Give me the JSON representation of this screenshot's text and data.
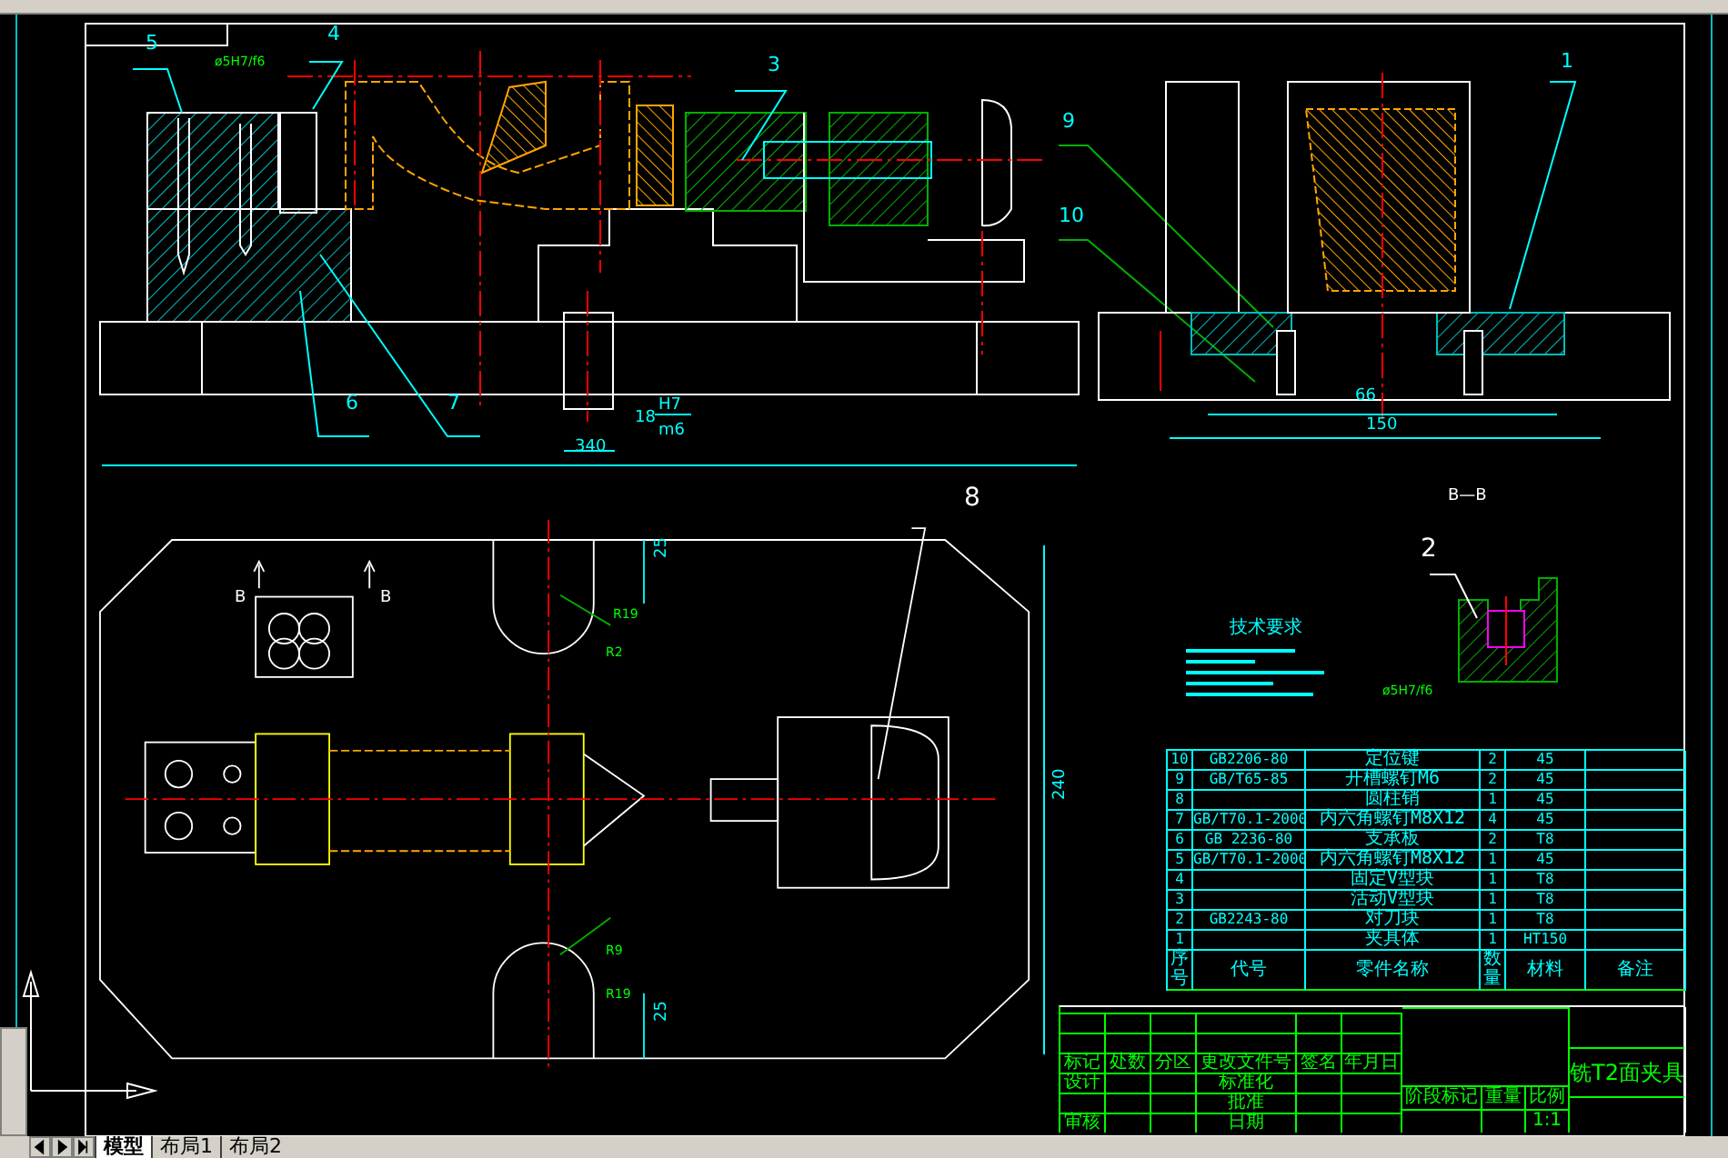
{
  "labels": [
    {
      "kind": "part",
      "text": "5"
    },
    {
      "kind": "fit",
      "text": "ø5H7/f6"
    },
    {
      "kind": "part",
      "text": "4"
    },
    {
      "kind": "part",
      "text": "3"
    },
    {
      "kind": "part",
      "text": "9"
    },
    {
      "kind": "part",
      "text": "10"
    },
    {
      "kind": "part",
      "text": "1"
    },
    {
      "kind": "part",
      "text": "6"
    },
    {
      "kind": "part",
      "text": "7"
    },
    {
      "kind": "dim",
      "text": "18"
    },
    {
      "kind": "dim",
      "text": "H7"
    },
    {
      "kind": "dim",
      "text": "m6"
    },
    {
      "kind": "dim",
      "text": "340"
    },
    {
      "kind": "dim",
      "text": "66"
    },
    {
      "kind": "dim",
      "text": "150"
    },
    {
      "kind": "section",
      "text": "B—B"
    },
    {
      "kind": "callout",
      "text": "2"
    },
    {
      "kind": "fit",
      "text": "ø5H7/f6"
    },
    {
      "kind": "section",
      "text": "B"
    },
    {
      "kind": "section",
      "text": "B"
    },
    {
      "kind": "callout",
      "text": "8"
    },
    {
      "kind": "dim",
      "text": "25"
    },
    {
      "kind": "fit",
      "text": "R19"
    },
    {
      "kind": "fit",
      "text": "R2"
    },
    {
      "kind": "dim",
      "text": "240"
    },
    {
      "kind": "fit",
      "text": "R9"
    },
    {
      "kind": "fit",
      "text": "R19"
    },
    {
      "kind": "dim",
      "text": "25"
    }
  ],
  "notes": {
    "title": "技术要求"
  },
  "parts_list": {
    "rows": [
      [
        "10",
        "GB2206-80",
        "定位键",
        "2",
        "45",
        ""
      ],
      [
        "9",
        "GB/T65-85",
        "开槽螺钉M6",
        "2",
        "45",
        ""
      ],
      [
        "8",
        "",
        "圆柱销",
        "1",
        "45",
        ""
      ],
      [
        "7",
        "GB/T70.1-2000",
        "内六角螺钉M8X12",
        "4",
        "45",
        ""
      ],
      [
        "6",
        "GB 2236-80",
        "支承板",
        "2",
        "T8",
        ""
      ],
      [
        "5",
        "GB/T70.1-2000",
        "内六角螺钉M8X12",
        "1",
        "45",
        ""
      ],
      [
        "4",
        "",
        "固定V型块",
        "1",
        "T8",
        ""
      ],
      [
        "3",
        "",
        "活动V型块",
        "1",
        "T8",
        ""
      ],
      [
        "2",
        "GB2243-80",
        "对刀块",
        "1",
        "T8",
        ""
      ],
      [
        "1",
        "",
        "夹具体",
        "1",
        "HT150",
        ""
      ]
    ],
    "header": [
      "序号",
      "代号",
      "零件名称",
      "数量",
      "材料",
      "备注"
    ]
  },
  "title_block": {
    "sign_header": [
      "标记",
      "处数",
      "分区",
      "更改文件号",
      "签名",
      "年月日"
    ],
    "sign_rows": [
      [
        "设计",
        "",
        "",
        "标准化",
        "",
        ""
      ],
      [
        "",
        "",
        "",
        "批准",
        "",
        ""
      ],
      [
        "审核",
        "",
        "",
        "日期",
        "",
        ""
      ]
    ],
    "stage_header": [
      "阶段标记",
      "重量",
      "比例"
    ],
    "scale": "1:1",
    "title": "铣T2面夹具"
  },
  "tabs": [
    {
      "label": "模型",
      "selected": true
    },
    {
      "label": "布局1",
      "selected": false
    },
    {
      "label": "布局2",
      "selected": false
    }
  ]
}
